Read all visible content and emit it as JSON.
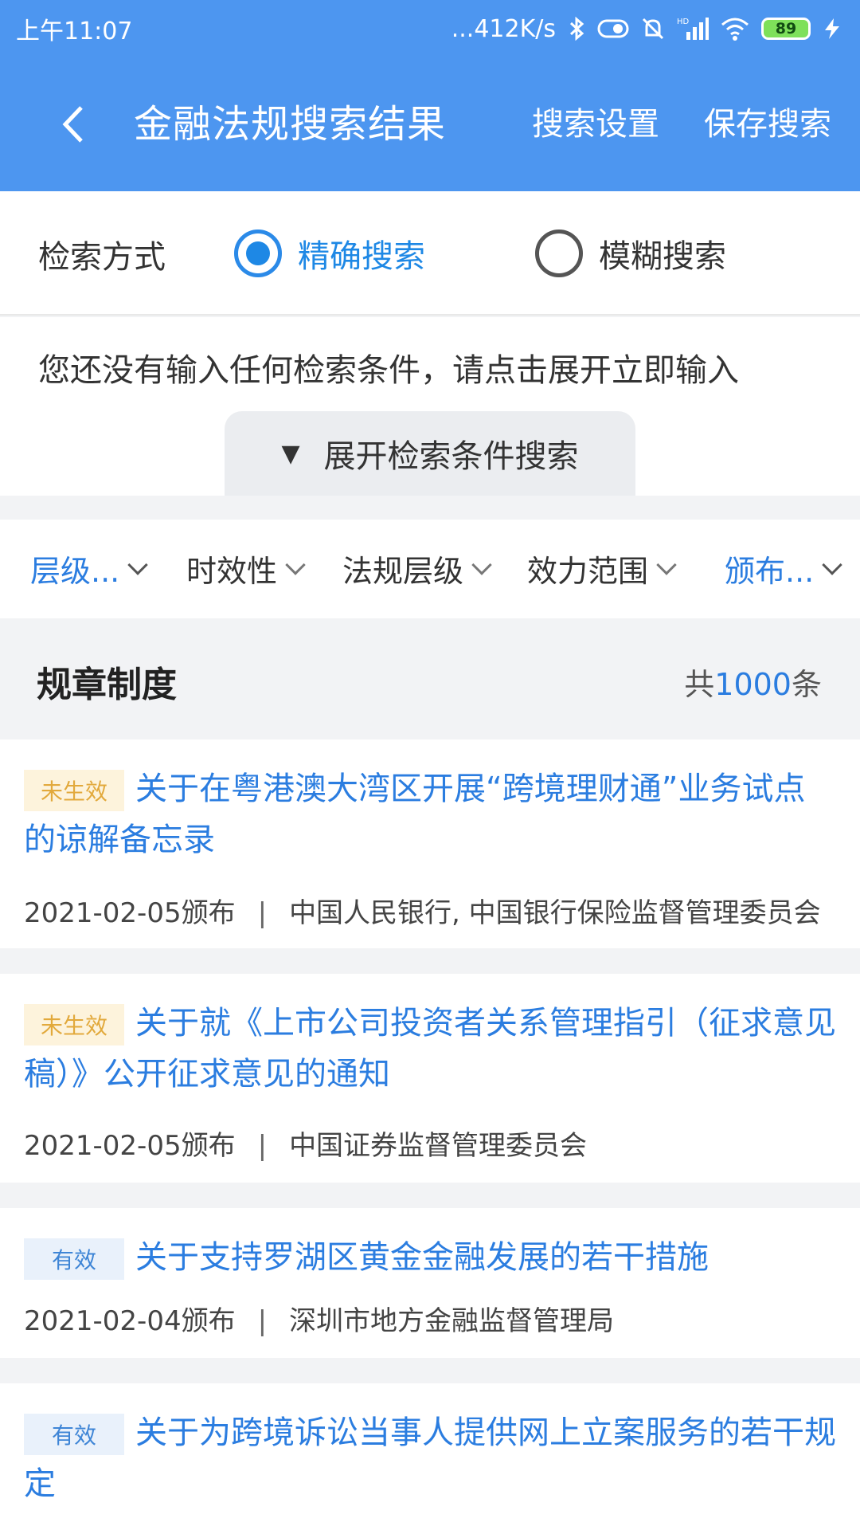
{
  "status": {
    "time": "上午11:07",
    "network_speed": "...412K/s",
    "battery": "89",
    "icons": [
      "bluetooth-icon",
      "toggle-icon",
      "alarm-muted-icon",
      "signal-hd-icon",
      "wifi-icon",
      "battery-icon",
      "charging-icon"
    ]
  },
  "header": {
    "title": "金融法规搜索结果",
    "settings_label": "搜索设置",
    "save_label": "保存搜索",
    "bg_color": "#4d96f0"
  },
  "search_mode": {
    "label": "检索方式",
    "options": [
      {
        "label": "精确搜索",
        "selected": true
      },
      {
        "label": "模糊搜索",
        "selected": false
      }
    ]
  },
  "hint": {
    "text": "您还没有输入任何检索条件，请点击展开立即输入",
    "expand_label": "展开检索条件搜索"
  },
  "filters": [
    {
      "label": "层级...",
      "active": true
    },
    {
      "label": "时效性",
      "active": false
    },
    {
      "label": "法规层级",
      "active": false
    },
    {
      "label": "效力范围",
      "active": false
    },
    {
      "label": "颁布...",
      "active": true
    }
  ],
  "section": {
    "title": "规章制度",
    "count_prefix": "共",
    "count": "1000",
    "count_suffix": "条"
  },
  "results": [
    {
      "status": "未生效",
      "title": "关于在粤港澳大湾区开展“跨境理财通”业务试点的谅解备忘录",
      "date": "2021-02-05颁布",
      "issuer": "中国人民银行, 中国银行保险监督管理委员会"
    },
    {
      "status": "未生效",
      "title": "关于就《上市公司投资者关系管理指引（征求意见稿）》公开征求意见的通知",
      "date": "2021-02-05颁布",
      "issuer": "中国证券监督管理委员会"
    },
    {
      "status": "有效",
      "title": "关于支持罗湖区黄金金融发展的若干措施",
      "date": "2021-02-04颁布",
      "issuer": "深圳市地方金融监督管理局"
    },
    {
      "status": "有效",
      "title": "关于为跨境诉讼当事人提供网上立案服务的若干规定",
      "date": "",
      "issuer": ""
    }
  ],
  "meta_separator": "|"
}
